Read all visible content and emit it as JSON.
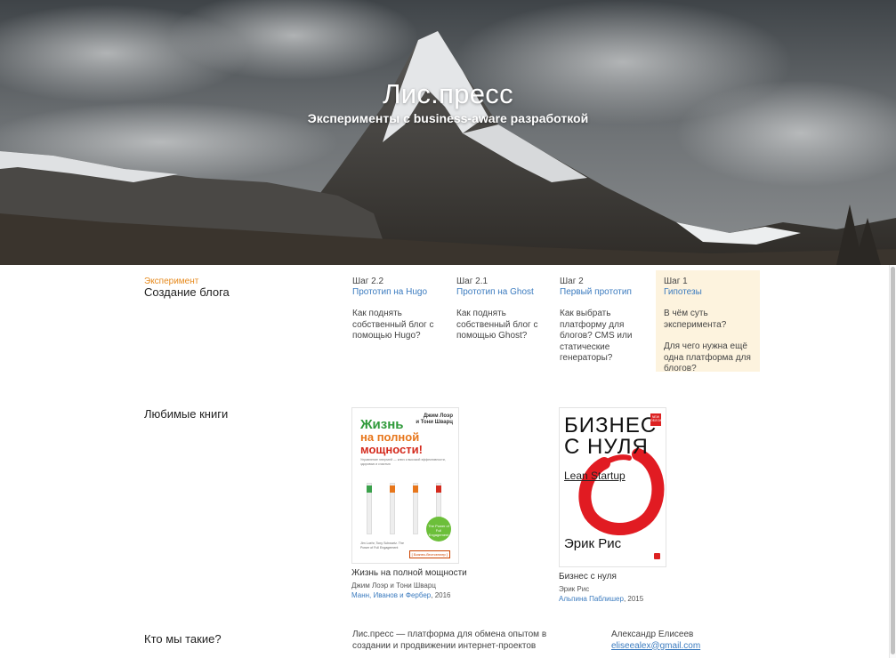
{
  "hero": {
    "title": "Лис.пресс",
    "subtitle": "Эксперименты с business-aware разработкой"
  },
  "experiment": {
    "kicker": "Эксперимент",
    "title": "Создание блога",
    "steps": [
      {
        "num": "Шаг 2.2",
        "link": "Прототип на Hugo",
        "questions": [
          "Как поднять собственный блог с помощью Hugo?"
        ],
        "active": false
      },
      {
        "num": "Шаг 2.1",
        "link": "Прототип на Ghost",
        "questions": [
          "Как поднять собственный блог с помощью Ghost?"
        ],
        "active": false
      },
      {
        "num": "Шаг 2",
        "link": "Первый прототип",
        "questions": [
          "Как выбрать платформу для блогов? CMS или статические генераторы?"
        ],
        "active": false
      },
      {
        "num": "Шаг 1",
        "link": "Гипотезы",
        "questions": [
          "В чём суть эксперимента?",
          "Для чего нужна ещё одна платформа для блогов?"
        ],
        "active": true
      }
    ]
  },
  "books": {
    "heading": "Любимые книги",
    "items": [
      {
        "title": "Жизнь на полной мощности",
        "author": "Джим Лоэр и Тони Шварц",
        "publisher": "Манн, Иванов и Фербер",
        "year": ", 2016",
        "cover": {
          "authors": [
            "Джим Лоэр",
            "и Тони Шварц"
          ],
          "line1": "Жизнь",
          "line2": "на полной",
          "line3": "мощности!",
          "subtitle": "Управление энергией — ключ к высокой эффективности, здоровью и счастью",
          "badge": "The Power of Full Engagement",
          "footer": "Jim Loehr, Tony Schwartz. The Power of Full Engagement",
          "tag": "[ Бизнес-бестселлер ]"
        }
      },
      {
        "title": "Бизнес с нуля",
        "author": "Эрик Рис",
        "publisher": "Альпина Паблишер",
        "year": ", 2015",
        "cover": {
          "line1": "БИЗНЕС",
          "line2": "С НУЛЯ",
          "lean": "Lean Startup",
          "author": "Эрик Рис",
          "badge": "NEW ОБЛОЖКА"
        }
      }
    ]
  },
  "about": {
    "heading": "Кто мы такие?",
    "text": "Лис.пресс — платформа для обмена опытом в создании и продвижении интернет-проектов",
    "name": "Александр Елисеев",
    "email": "eliseealex@gmail.com"
  },
  "colors": {
    "accent_orange": "#e68a1e",
    "link_blue": "#3b7bbf",
    "active_step_bg": "#fdf3de",
    "enso_red": "#e11b22"
  }
}
